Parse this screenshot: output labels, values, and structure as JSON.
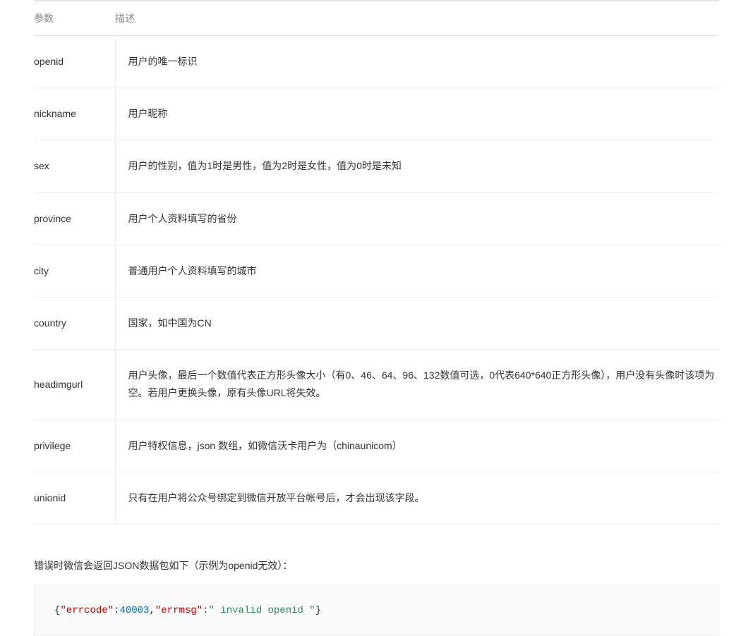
{
  "table": {
    "headers": {
      "param": "参数",
      "desc": "描述"
    },
    "rows": [
      {
        "param": "openid",
        "desc": "用户的唯一标识"
      },
      {
        "param": "nickname",
        "desc": "用户昵称"
      },
      {
        "param": "sex",
        "desc": "用户的性别，值为1时是男性，值为2时是女性，值为0时是未知"
      },
      {
        "param": "province",
        "desc": "用户个人资料填写的省份"
      },
      {
        "param": "city",
        "desc": "普通用户个人资料填写的城市"
      },
      {
        "param": "country",
        "desc": "国家，如中国为CN"
      },
      {
        "param": "headimgurl",
        "desc": "用户头像，最后一个数值代表正方形头像大小（有0、46、64、96、132数值可选，0代表640*640正方形头像），用户没有头像时该项为空。若用户更换头像，原有头像URL将失效。"
      },
      {
        "param": "privilege",
        "desc": "用户特权信息，json 数组，如微信沃卡用户为（chinaunicom）"
      },
      {
        "param": "unionid",
        "desc": "只有在用户将公众号绑定到微信开放平台帐号后，才会出现该字段。"
      }
    ]
  },
  "error_intro": "错误时微信会返回JSON数据包如下（示例为openid无效）：",
  "code": {
    "brace_open": "{",
    "key1": "\"errcode\"",
    "colon": ":",
    "val1": "40003",
    "comma": ",",
    "key2": "\"errmsg\"",
    "val2": "\" invalid openid \"",
    "brace_close": "}"
  }
}
